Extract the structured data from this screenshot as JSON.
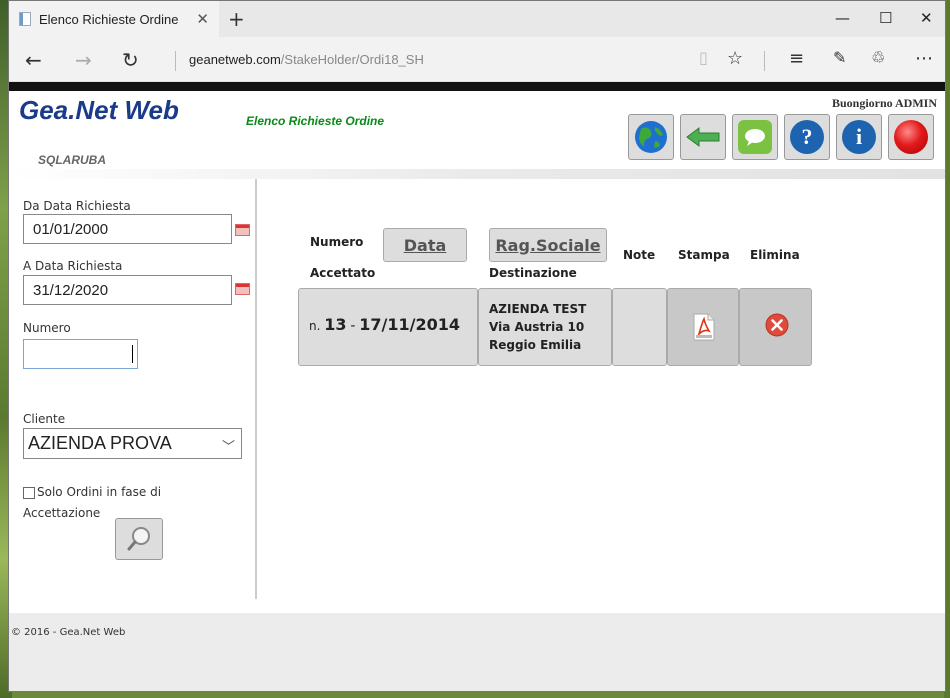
{
  "browser": {
    "tab_title": "Elenco Richieste Ordine",
    "url_host": "geanetweb.com",
    "url_path": "/StakeHolder/Ordi18_SH"
  },
  "header": {
    "logo": "Gea.Net Web",
    "subtitle": "Elenco Richieste Ordine",
    "db_name": "SQLARUBA",
    "greeting": "Buongiorno ADMIN"
  },
  "toolbar": {
    "buttons": [
      {
        "icon": "globe-icon",
        "color": "#1f6fd0"
      },
      {
        "icon": "arrow-left-icon",
        "color": "#4caf50"
      },
      {
        "icon": "chat-icon",
        "color": "#7cc242"
      },
      {
        "icon": "help-icon",
        "color": "#1e63b0",
        "glyph": "?"
      },
      {
        "icon": "info-icon",
        "color": "#1e63b0",
        "glyph": "i"
      },
      {
        "icon": "exit-icon",
        "color": "#e21b1b"
      }
    ]
  },
  "filters": {
    "date_from_label": "Da Data Richiesta",
    "date_from_value": "01/01/2000",
    "date_to_label": "A Data Richiesta",
    "date_to_value": "31/12/2020",
    "number_label": "Numero",
    "number_value": "",
    "client_label": "Cliente",
    "client_value": "AZIENDA PROVA",
    "checkbox_label_1": "Solo Ordini in fase di",
    "checkbox_label_2": "Accettazione",
    "checkbox_checked": false
  },
  "table": {
    "headers": {
      "numero": "Numero",
      "accettato": "Accettato",
      "data": "Data",
      "rag_sociale": "Rag.Sociale",
      "destinazione": "Destinazione",
      "note": "Note",
      "stampa": "Stampa",
      "elimina": "Elimina"
    },
    "rows": [
      {
        "prefix": "n.",
        "number": "13",
        "dash": "-",
        "date": "17/11/2014",
        "company": "AZIENDA TEST",
        "street": "Via Austria 10",
        "city": "Reggio Emilia",
        "note": ""
      }
    ]
  },
  "footer": {
    "text": "© 2016 - Gea.Net Web"
  }
}
